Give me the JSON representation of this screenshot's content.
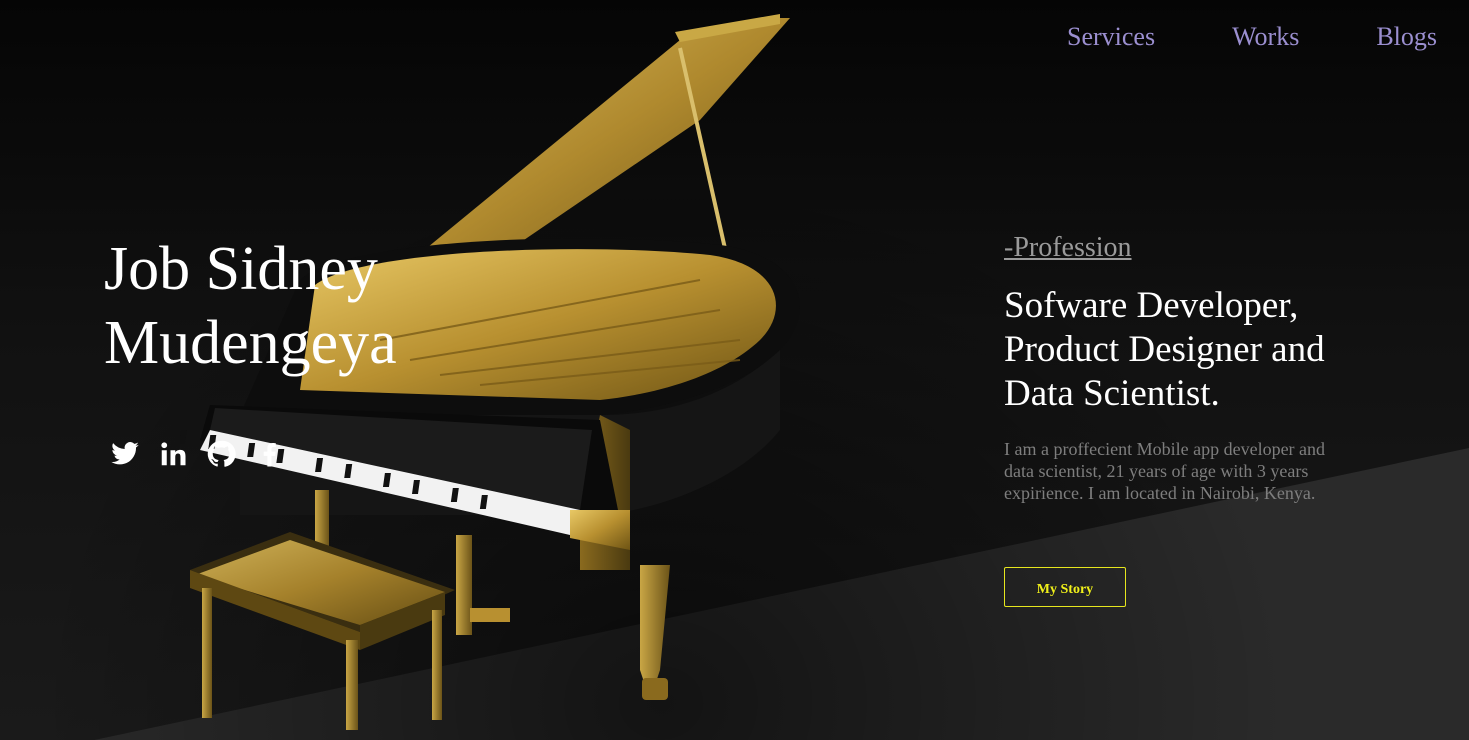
{
  "nav": {
    "items": [
      {
        "label": "Services"
      },
      {
        "label": "Works"
      },
      {
        "label": "Blogs"
      }
    ]
  },
  "hero": {
    "name": "Job Sidney\nMudengeya",
    "socials": [
      {
        "icon": "twitter-icon"
      },
      {
        "icon": "linkedin-icon"
      },
      {
        "icon": "github-icon"
      },
      {
        "icon": "facebook-icon"
      }
    ]
  },
  "profession": {
    "label": "-Profession",
    "title": "Sofware Developer, Product Designer and Data Scientist.",
    "bio": "I am a proffecient Mobile app developer and data scientist, 21 years of age with 3 years expirience. I am located in Nairobi, Kenya.",
    "button_label": "My Story"
  },
  "colors": {
    "nav_text": "#9b8fd0",
    "accent_yellow": "#f0f01a",
    "background": "#0b0b0b",
    "floor": "#2a2a2a"
  }
}
